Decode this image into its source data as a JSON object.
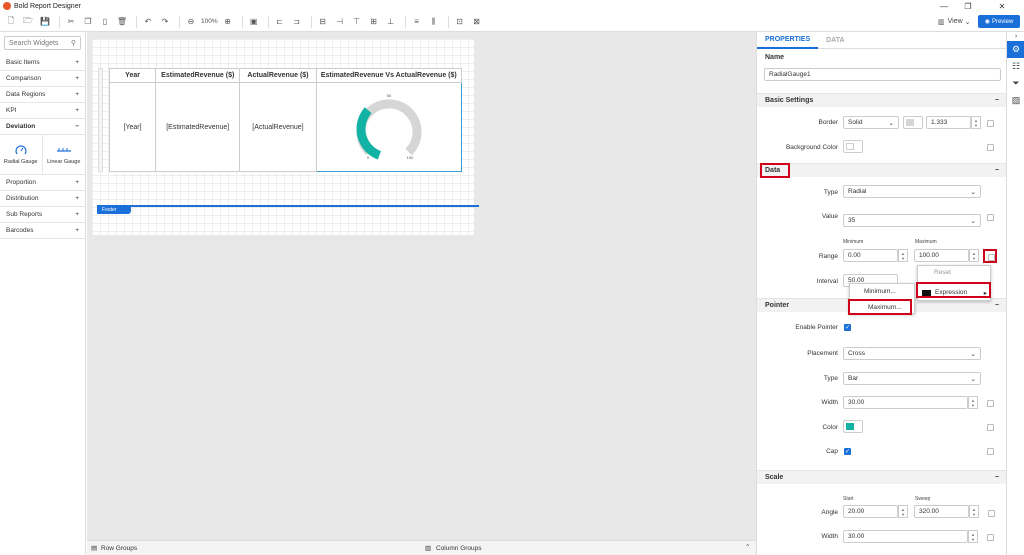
{
  "app": {
    "title": "Bold Report Designer"
  },
  "toolbar": {
    "zoom": "100%",
    "view_label": "View",
    "preview_label": "Preview"
  },
  "left_panel": {
    "search_placeholder": "Search Widgets",
    "categories_top": [
      "Basic Items",
      "Comparison",
      "Data Regions",
      "KPI"
    ],
    "selected_category": "Deviation",
    "widgets": [
      "Radial Gauge",
      "Linear Gauge"
    ],
    "categories_bottom": [
      "Proportion",
      "Distribution",
      "Sub Reports",
      "Barcodes"
    ]
  },
  "report": {
    "headers": [
      "Year",
      "EstimatedRevenue ($)",
      "ActualRevenue ($)",
      "EstimatedRevenue Vs ActualRevenue ($)"
    ],
    "cells": [
      "[Year]",
      "[EstimatedRevenue]",
      "[ActualRevenue]"
    ],
    "gauge_labels": [
      "0",
      "50",
      "100"
    ],
    "footer_label": "Footer"
  },
  "bottom": {
    "row_groups": "Row Groups",
    "column_groups": "Column Groups"
  },
  "properties": {
    "tabs": [
      "PROPERTIES",
      "DATA"
    ],
    "name_label": "Name",
    "name_value": "RadialGauge1",
    "basic_settings": "Basic Settings",
    "border_label": "Border",
    "border_style": "Solid",
    "border_width": "1.333",
    "bgcolor_label": "Background Color",
    "data_section": "Data",
    "type_label": "Type",
    "type_value": "Radial",
    "value_label": "Value",
    "value_value": "35",
    "range_label": "Range",
    "min_label": "Minimum",
    "max_label": "Maximum",
    "min_value": "0.00",
    "max_value": "100.00",
    "interval_label": "Interval",
    "interval_value": "50.00",
    "pointer_section": "Pointer",
    "enable_pointer_label": "Enable Pointer",
    "placement_label": "Placement",
    "placement_value": "Cross",
    "ptype_label": "Type",
    "ptype_value": "Bar",
    "width_label": "Width",
    "width_value": "30.00",
    "color_label": "Color",
    "cap_label": "Cap",
    "scale_section": "Scale",
    "start_label": "Start",
    "sweep_label": "Sweep",
    "angle_label": "Angle",
    "angle_start": "20.00",
    "angle_sweep": "320.00",
    "scale_width_label": "Width",
    "scale_width_value": "30.00"
  },
  "menu": {
    "reset": "Reset",
    "expression": "Expression",
    "minimum": "Minimum...",
    "maximum": "Maximum..."
  },
  "colors": {
    "accent": "#1a6fd8",
    "gauge": "#12b3a4",
    "highlight": "#d0021b"
  }
}
